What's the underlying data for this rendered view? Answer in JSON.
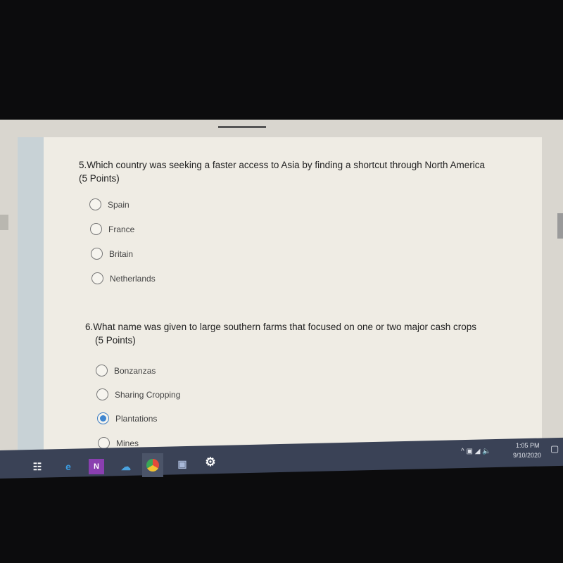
{
  "questions": [
    {
      "number": "5.",
      "text": "Which country was seeking a faster access to Asia by finding a shortcut through North America",
      "points": "(5 Points)",
      "options": [
        {
          "label": "Spain",
          "selected": false
        },
        {
          "label": "France",
          "selected": false
        },
        {
          "label": "Britain",
          "selected": false
        },
        {
          "label": "Netherlands",
          "selected": false
        }
      ]
    },
    {
      "number": "6.",
      "text": "What name was given to large southern farms that focused on one or two major cash crops",
      "points": "(5 Points)",
      "options": [
        {
          "label": "Bonzanzas",
          "selected": false
        },
        {
          "label": "Sharing Cropping",
          "selected": false
        },
        {
          "label": "Plantations",
          "selected": true
        },
        {
          "label": "Mines",
          "selected": false
        }
      ]
    }
  ],
  "taskbar": {
    "icons": [
      "task-view-icon",
      "edge-icon",
      "onenote-icon",
      "onedrive-icon",
      "chrome-icon",
      "camera-icon",
      "settings-icon"
    ],
    "time": "1:05 PM",
    "date": "9/10/2020"
  },
  "colors": {
    "accent": "#3f86d0",
    "taskbar": "#3a4256"
  }
}
